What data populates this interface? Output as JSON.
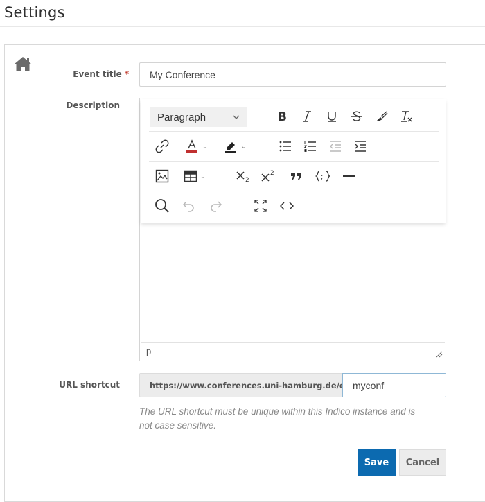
{
  "page": {
    "title": "Settings"
  },
  "form": {
    "event_title": {
      "label": "Event title",
      "required_marker": "*",
      "value": "My Conference"
    },
    "description": {
      "label": "Description",
      "editor": {
        "block_format": "Paragraph",
        "status_path": "p",
        "toolbar_rows": [
          [
            "block-format",
            "bold",
            "italic",
            "underline",
            "strikethrough",
            "format-painter",
            "clear-formatting"
          ],
          [
            "link",
            "text-color",
            "highlight-color",
            "bulleted-list",
            "numbered-list",
            "outdent",
            "indent"
          ],
          [
            "insert-image",
            "insert-table",
            "subscript",
            "superscript",
            "blockquote",
            "code-sample",
            "horizontal-rule"
          ],
          [
            "find-replace",
            "undo",
            "redo",
            "fullscreen",
            "source-code"
          ]
        ]
      }
    },
    "url_shortcut": {
      "label": "URL shortcut",
      "prefix": "https://www.conferences.uni-hamburg.de/e/",
      "value": "myconf",
      "help": "The URL shortcut must be unique within this Indico instance and is not case sensitive."
    }
  },
  "actions": {
    "save_label": "Save",
    "cancel_label": "Cancel"
  },
  "colors": {
    "primary": "#0c6ab0",
    "required": "#c0392b",
    "text_color_bar": "#c03030",
    "highlight_bar": "#222222"
  },
  "icons": {
    "home": "home-icon"
  }
}
